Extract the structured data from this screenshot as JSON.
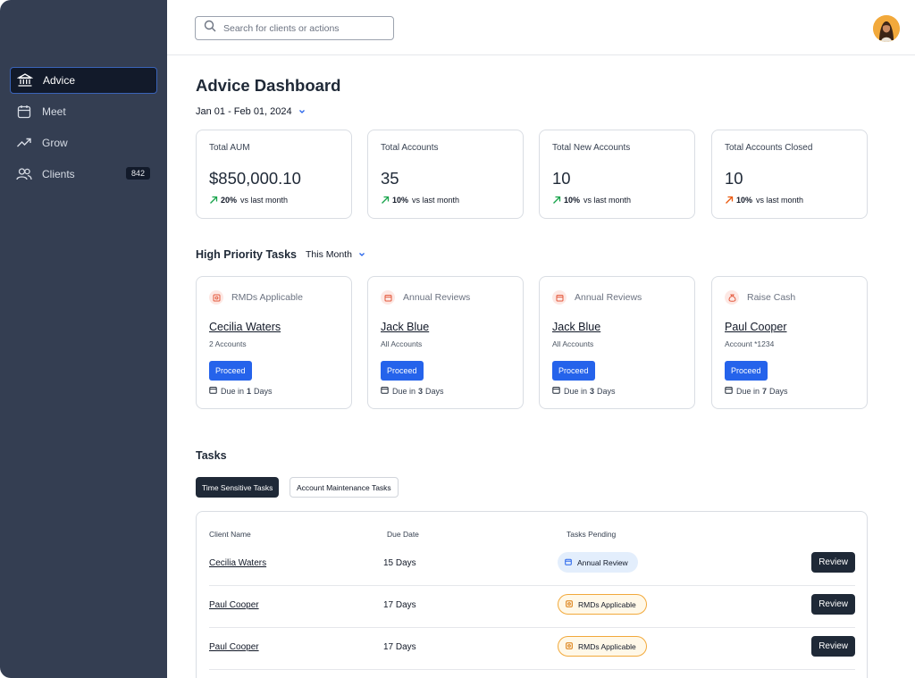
{
  "sidebar": {
    "items": [
      {
        "label": "Advice",
        "icon": "bank-icon"
      },
      {
        "label": "Meet",
        "icon": "calendar-icon"
      },
      {
        "label": "Grow",
        "icon": "trend-up-icon"
      },
      {
        "label": "Clients",
        "icon": "users-icon",
        "badge": "842"
      }
    ]
  },
  "header": {
    "search_placeholder": "Search for clients or actions"
  },
  "page": {
    "title": "Advice Dashboard",
    "date_range": "Jan 01 - Feb 01, 2024"
  },
  "stats": [
    {
      "label": "Total AUM",
      "value": "$850,000.10",
      "pct": "20%",
      "suffix": "vs last month",
      "trend_color": "#16a34a"
    },
    {
      "label": "Total Accounts",
      "value": "35",
      "pct": "10%",
      "suffix": "vs last month",
      "trend_color": "#16a34a"
    },
    {
      "label": "Total New Accounts",
      "value": "10",
      "pct": "10%",
      "suffix": "vs last month",
      "trend_color": "#16a34a"
    },
    {
      "label": "Total Accounts Closed",
      "value": "10",
      "pct": "10%",
      "suffix": "vs last month",
      "trend_color": "#ea580c"
    }
  ],
  "priority": {
    "title": "High Priority Tasks",
    "filter": "This Month",
    "cards": [
      {
        "type": "RMDs Applicable",
        "client": "Cecilia Waters",
        "sub": "2 Accounts",
        "button": "Proceed",
        "due_prefix": "Due in",
        "due_num": "1",
        "due_unit": "Days",
        "icon": "receipt-icon"
      },
      {
        "type": "Annual Reviews",
        "client": "Jack Blue",
        "sub": "All Accounts",
        "button": "Proceed",
        "due_prefix": "Due in",
        "due_num": "3",
        "due_unit": "Days",
        "icon": "calendar-icon"
      },
      {
        "type": "Annual Reviews",
        "client": "Jack Blue",
        "sub": "All Accounts",
        "button": "Proceed",
        "due_prefix": "Due in",
        "due_num": "3",
        "due_unit": "Days",
        "icon": "calendar-icon"
      },
      {
        "type": "Raise Cash",
        "client": "Paul Cooper",
        "sub": "Account *1234",
        "button": "Proceed",
        "due_prefix": "Due in",
        "due_num": "7",
        "due_unit": "Days",
        "icon": "money-bag-icon"
      }
    ]
  },
  "tasks": {
    "title": "Tasks",
    "tabs": [
      "Time Sensitive Tasks",
      "Account Maintenance Tasks"
    ],
    "columns": [
      "Client Name",
      "Due Date",
      "Tasks Pending"
    ],
    "rows": [
      {
        "client": "Cecilia Waters",
        "due": "15 Days",
        "task": "Annual Review",
        "action": "Review"
      },
      {
        "client": "Paul Cooper",
        "due": "17 Days",
        "task": "RMDs Applicable",
        "action": "Review"
      },
      {
        "client": "Paul Cooper",
        "due": "17 Days",
        "task": "RMDs Applicable",
        "action": "Review"
      }
    ]
  },
  "colors": {
    "sidebar_bg": "#343e52",
    "active_nav_bg": "#121a2a",
    "primary_button": "#2563eb",
    "dark_button": "#1f2937",
    "trend_up": "#16a34a",
    "trend_warning": "#ea580c",
    "pill_amber_border": "#f2a93b",
    "pill_blue_bg": "#e3eefc"
  }
}
